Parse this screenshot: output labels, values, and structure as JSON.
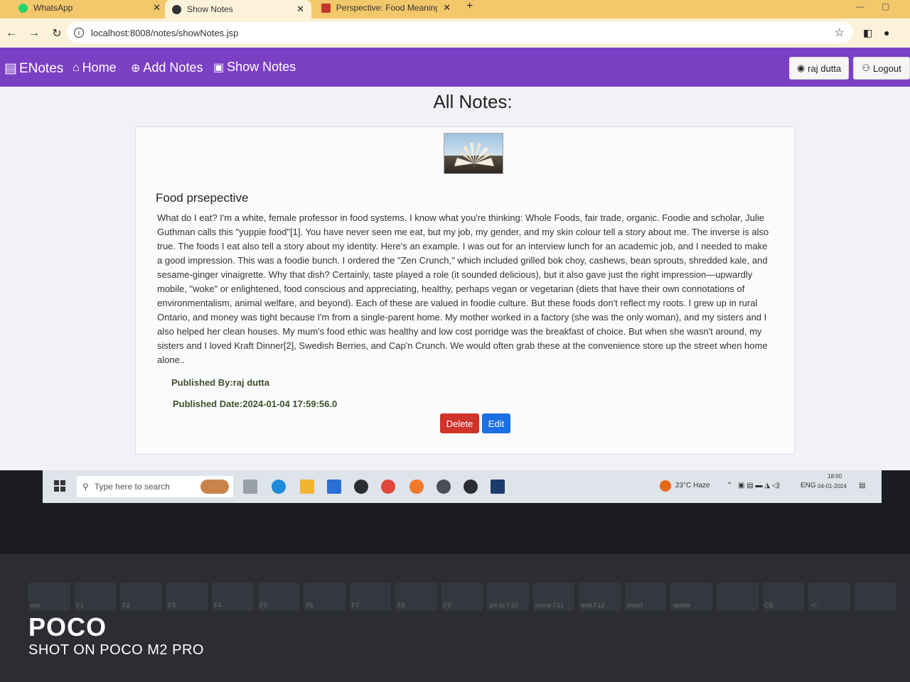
{
  "browser": {
    "tabs": [
      {
        "label": "WhatsApp",
        "active": false
      },
      {
        "label": "Show Notes",
        "active": true
      },
      {
        "label": "Perspective: Food Meanings – F",
        "active": false
      }
    ],
    "url": "localhost:8008/notes/showNotes.jsp"
  },
  "navbar": {
    "brand": "ENotes",
    "links": [
      "Home",
      "Add Notes",
      "Show Notes"
    ],
    "user_button": "raj dutta",
    "logout_button": "Logout"
  },
  "page": {
    "title": "All Notes:"
  },
  "note": {
    "title": "Food prsepective",
    "body": "What do I eat? I'm a white, female professor in food systems. I know what you're thinking: Whole Foods, fair trade, organic. Foodie and scholar, Julie Guthman calls this \"yuppie food\"[1]. You have never seen me eat, but my job, my gender, and my skin colour tell a story about me. The inverse is also true. The foods I eat also tell a story about my identity. Here's an example. I was out for an interview lunch for an academic job, and I needed to make a good impression. This was a foodie bunch. I ordered the \"Zen Crunch,\" which included grilled bok choy, cashews, bean sprouts, shredded kale, and sesame-ginger vinaigrette. Why that dish? Certainly, taste played a role (it sounded delicious), but it also gave just the right impression—upwardly mobile, \"woke\" or enlightened, food conscious and appreciating, healthy, perhaps vegan or vegetarian (diets that have their own connotations of environmentalism, animal welfare, and beyond). Each of these are valued in foodie culture. But these foods don't reflect my roots. I grew up in rural Ontario, and money was tight because I'm from a single-parent home. My mother worked in a factory (she was the only woman), and my sisters and I also helped her clean houses. My mum's food ethic was healthy and low cost porridge was the breakfast of choice. But when she wasn't around, my sisters and I loved Kraft Dinner[2], Swedish Berries, and Cap'n Crunch. We would often grab these at the convenience store up the street when home alone..",
    "published_by": "Published By:raj dutta",
    "published_date": "Published Date:2024-01-04 17:59:56.0",
    "delete_label": "Delete",
    "edit_label": "Edit"
  },
  "taskbar": {
    "search_placeholder": "Type here to search",
    "weather": "23°C Haze",
    "lang": "ENG",
    "time": "18:00",
    "date": "04-01-2024"
  },
  "keyboard": {
    "keys": [
      "esc",
      "F1",
      "F2",
      "F3",
      "F4",
      "F5",
      "F6",
      "F7",
      "F8",
      "F9",
      "prt sc F10",
      "home F11",
      "end F12",
      "insert",
      "delete",
      "",
      "CE",
      "+/-",
      ""
    ]
  },
  "watermark": {
    "brand": "POCO",
    "subtitle": "SHOT ON POCO M2 PRO"
  },
  "colors": {
    "navbar": "#7b3fc4",
    "tabbar": "#f3c86b",
    "delete": "#d1332b",
    "edit": "#1b6fe4"
  }
}
